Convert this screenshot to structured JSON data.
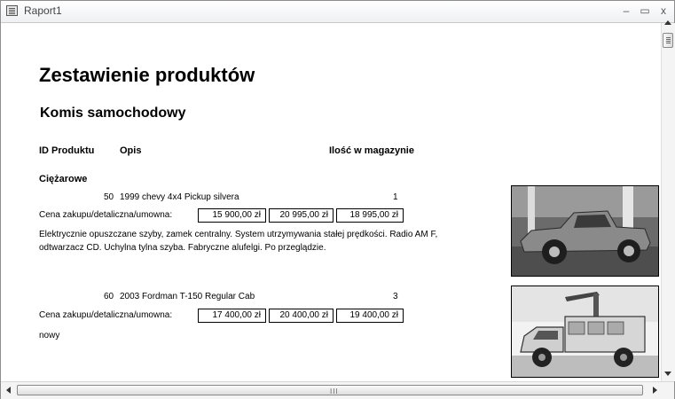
{
  "window": {
    "title": "Raport1",
    "minimize": "–",
    "maximize": "▭",
    "close": "x"
  },
  "report": {
    "title": "Zestawienie produktów",
    "subtitle": "Komis samochodowy",
    "columns": {
      "id": "ID Produktu",
      "desc": "Opis",
      "stock": "Ilość w magazynie"
    },
    "category": "Ciężarowe",
    "price_label": "Cena zakupu/detaliczna/umowna:",
    "products": [
      {
        "id": "50",
        "name": "1999 chevy 4x4 Pickup silvera",
        "stock": "1",
        "prices": [
          "15 900,00 zł",
          "20 995,00 zł",
          "18 995,00 zł"
        ],
        "notes": [
          "Elektrycznie opuszczane szyby, zamek centralny. System utrzymywania stałej prędkości. Radio AM F,",
          "odtwarzacz CD. Uchylna tylna szyba. Fabryczne alufelgi. Po przeglądzie."
        ]
      },
      {
        "id": "60",
        "name": "2003 Fordman T-150 Regular Cab",
        "stock": "3",
        "prices": [
          "17 400,00 zł",
          "20 400,00 zł",
          "19 400,00 zł"
        ],
        "notes": [
          "nowy"
        ]
      }
    ]
  },
  "scrollbar": {
    "grip": "III"
  }
}
